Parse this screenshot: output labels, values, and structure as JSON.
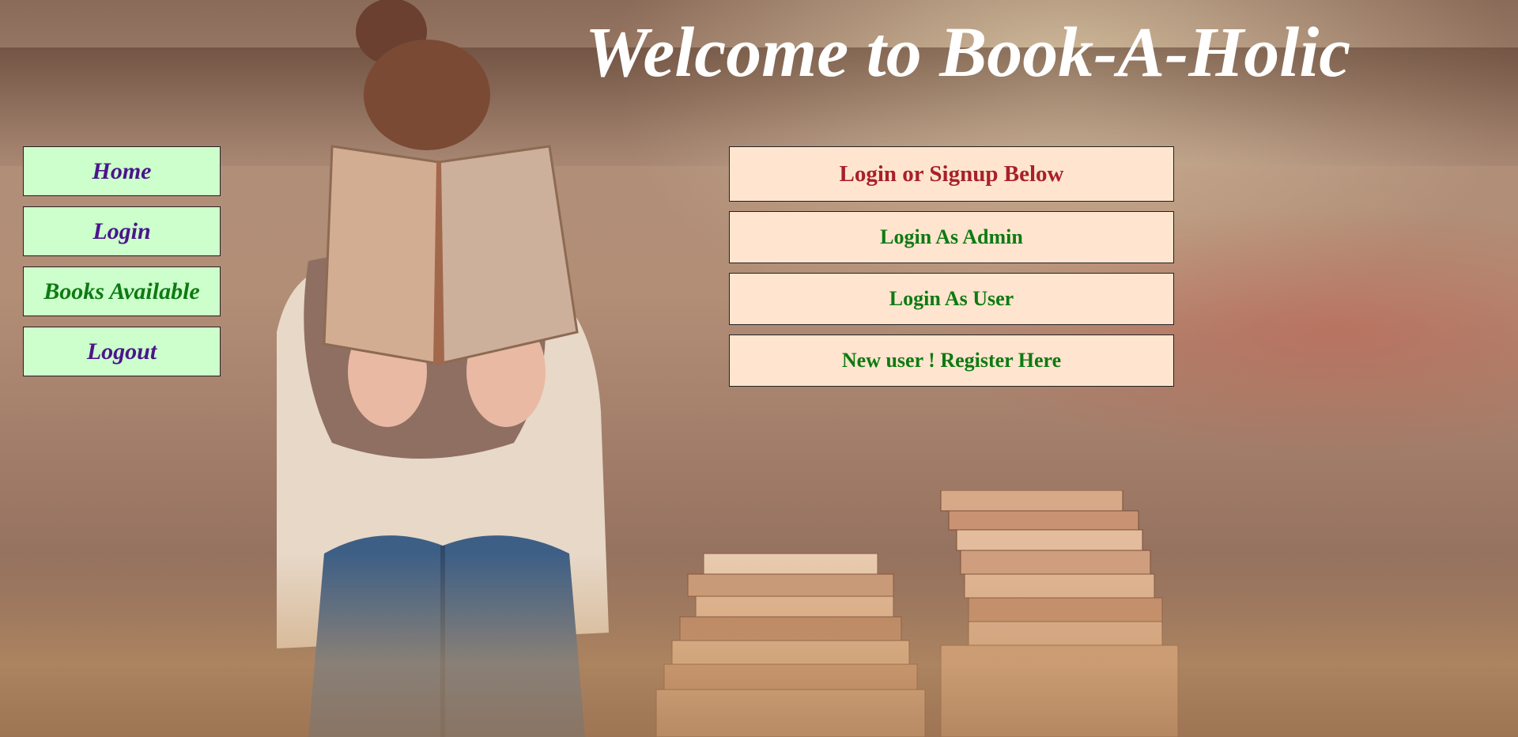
{
  "header": {
    "title": "Welcome to Book-A-Holic"
  },
  "sidebar": {
    "items": [
      {
        "label": "Home"
      },
      {
        "label": "Login"
      },
      {
        "label": "Books Available"
      },
      {
        "label": "Logout"
      }
    ]
  },
  "login_panel": {
    "heading": "Login or Signup Below",
    "admin_label": "Login As Admin",
    "user_label": "Login As User",
    "register_label": "New user ! Register Here"
  },
  "colors": {
    "nav_background": "#ccffcc",
    "nav_text_purple": "#4b148c",
    "nav_text_green": "#0e7a12",
    "panel_background": "#ffe5cf",
    "panel_heading_text": "#a8202a",
    "panel_button_text": "#0e7a12",
    "title_text": "#ffffff"
  },
  "background": {
    "description_icon": "reading-woman-with-books-photo"
  }
}
